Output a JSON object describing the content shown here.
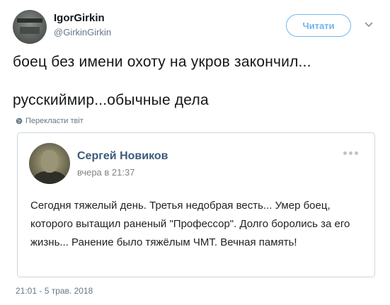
{
  "author": {
    "name": "IgorGirkin",
    "handle": "@GirkinGirkin"
  },
  "follow_button": {
    "label": "Читати"
  },
  "tweet": {
    "line1": "боец без имени охоту на укров закончил...",
    "line2": "русскиймир...обычные дела",
    "translate_label": "Перекласти твіт"
  },
  "quoted_post": {
    "name": "Сергей Новиков",
    "time": "вчера в 21:37",
    "text": "Сегодня тяжелый день. Третья недобрая весть... Умер боец, которого вытащил раненый \"Профессор\". Долго боролись за его жизнь... Ранение было тяжёлым ЧМТ. Вечная память!"
  },
  "timestamp": "21:01 - 5 трав. 2018",
  "colors": {
    "accent": "#6fb6ef",
    "secondary_text": "#657786",
    "vk_name": "#3d5a7b"
  },
  "icons": {
    "caret": "chevron-down-icon",
    "globe": "globe-icon",
    "menu": "more-dots-icon"
  }
}
